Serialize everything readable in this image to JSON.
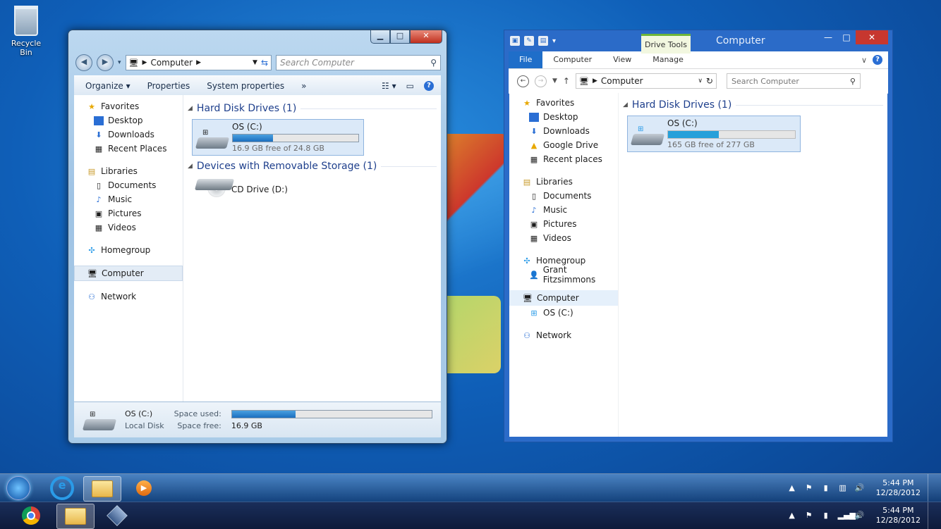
{
  "desktop": {
    "recycle_bin_label": "Recycle Bin"
  },
  "win7": {
    "caption_buttons": {
      "minimize": "▁",
      "maximize": "□",
      "close": "✕"
    },
    "address": {
      "root": "Computer"
    },
    "search_placeholder": "Search Computer",
    "toolbar": {
      "organize": "Organize ▾",
      "properties": "Properties",
      "system_properties": "System properties",
      "more": "»",
      "help": "?"
    },
    "nav": {
      "favorites": "Favorites",
      "desktop": "Desktop",
      "downloads": "Downloads",
      "recent_places": "Recent Places",
      "libraries": "Libraries",
      "documents": "Documents",
      "music": "Music",
      "pictures": "Pictures",
      "videos": "Videos",
      "homegroup": "Homegroup",
      "computer": "Computer",
      "network": "Network"
    },
    "groups": {
      "hard_disk": "Hard Disk Drives (1)",
      "removable": "Devices with Removable Storage (1)"
    },
    "drive_c": {
      "name": "OS (C:)",
      "free_text": "16.9 GB free of 24.8 GB",
      "used_fraction": 0.32
    },
    "drive_d": {
      "name": "CD Drive (D:)"
    },
    "details": {
      "name": "OS (C:)",
      "type": "Local Disk",
      "space_used_label": "Space used:",
      "space_free_label": "Space free:",
      "space_free_value": "16.9 GB",
      "used_fraction": 0.32
    }
  },
  "win8": {
    "title": "Computer",
    "contextual_tab": "Drive Tools",
    "caption_buttons": {
      "minimize": "—",
      "maximize": "□",
      "close": "✕"
    },
    "tabs": {
      "file": "File",
      "computer": "Computer",
      "view": "View",
      "manage": "Manage"
    },
    "address": {
      "root": "Computer"
    },
    "search_placeholder": "Search Computer",
    "nav": {
      "favorites": "Favorites",
      "desktop": "Desktop",
      "downloads": "Downloads",
      "google_drive": "Google Drive",
      "recent_places": "Recent places",
      "libraries": "Libraries",
      "documents": "Documents",
      "music": "Music",
      "pictures": "Pictures",
      "videos": "Videos",
      "homegroup": "Homegroup",
      "user": "Grant Fitzsimmons",
      "computer": "Computer",
      "os_c": "OS (C:)",
      "network": "Network"
    },
    "groups": {
      "hard_disk": "Hard Disk Drives (1)"
    },
    "drive_c": {
      "name": "OS (C:)",
      "free_text": "165 GB free of 277 GB",
      "used_fraction": 0.4
    }
  },
  "taskbar7": {
    "time": "5:44 PM",
    "date": "12/28/2012"
  },
  "taskbar8": {
    "time": "5:44 PM",
    "date": "12/28/2012"
  }
}
